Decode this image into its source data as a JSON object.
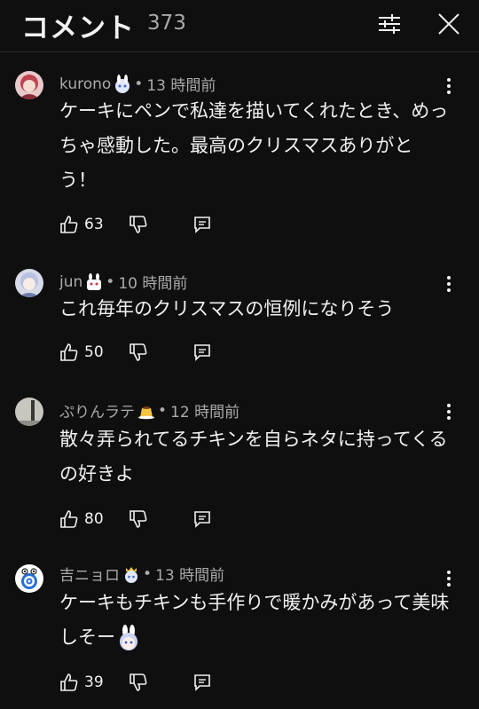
{
  "header": {
    "title": "コメント",
    "count": "373"
  },
  "comments": [
    {
      "author": "kurono",
      "time": "13 時間前",
      "text": "ケーキにペンで私達を描いてくれたとき、めっちゃ感動した。最高のクリスマスありがとう！",
      "likes": "63"
    },
    {
      "author": "jun",
      "time": "10 時間前",
      "text": "これ毎年のクリスマスの恒例になりそう",
      "likes": "50"
    },
    {
      "author": "ぷりんラテ",
      "time": "12 時間前",
      "text": "散々弄られてるチキンを自らネタに持ってくるの好きよ",
      "likes": "80"
    },
    {
      "author": "吉ニョロ",
      "time": "13 時間前",
      "text": "ケーキもチキンも手作りで暖かみがあって美味しそー",
      "likes": "39"
    }
  ],
  "colors": {
    "background": "#0f0f0f",
    "text": "#f1f1f1",
    "secondary": "#aaaaaa"
  }
}
